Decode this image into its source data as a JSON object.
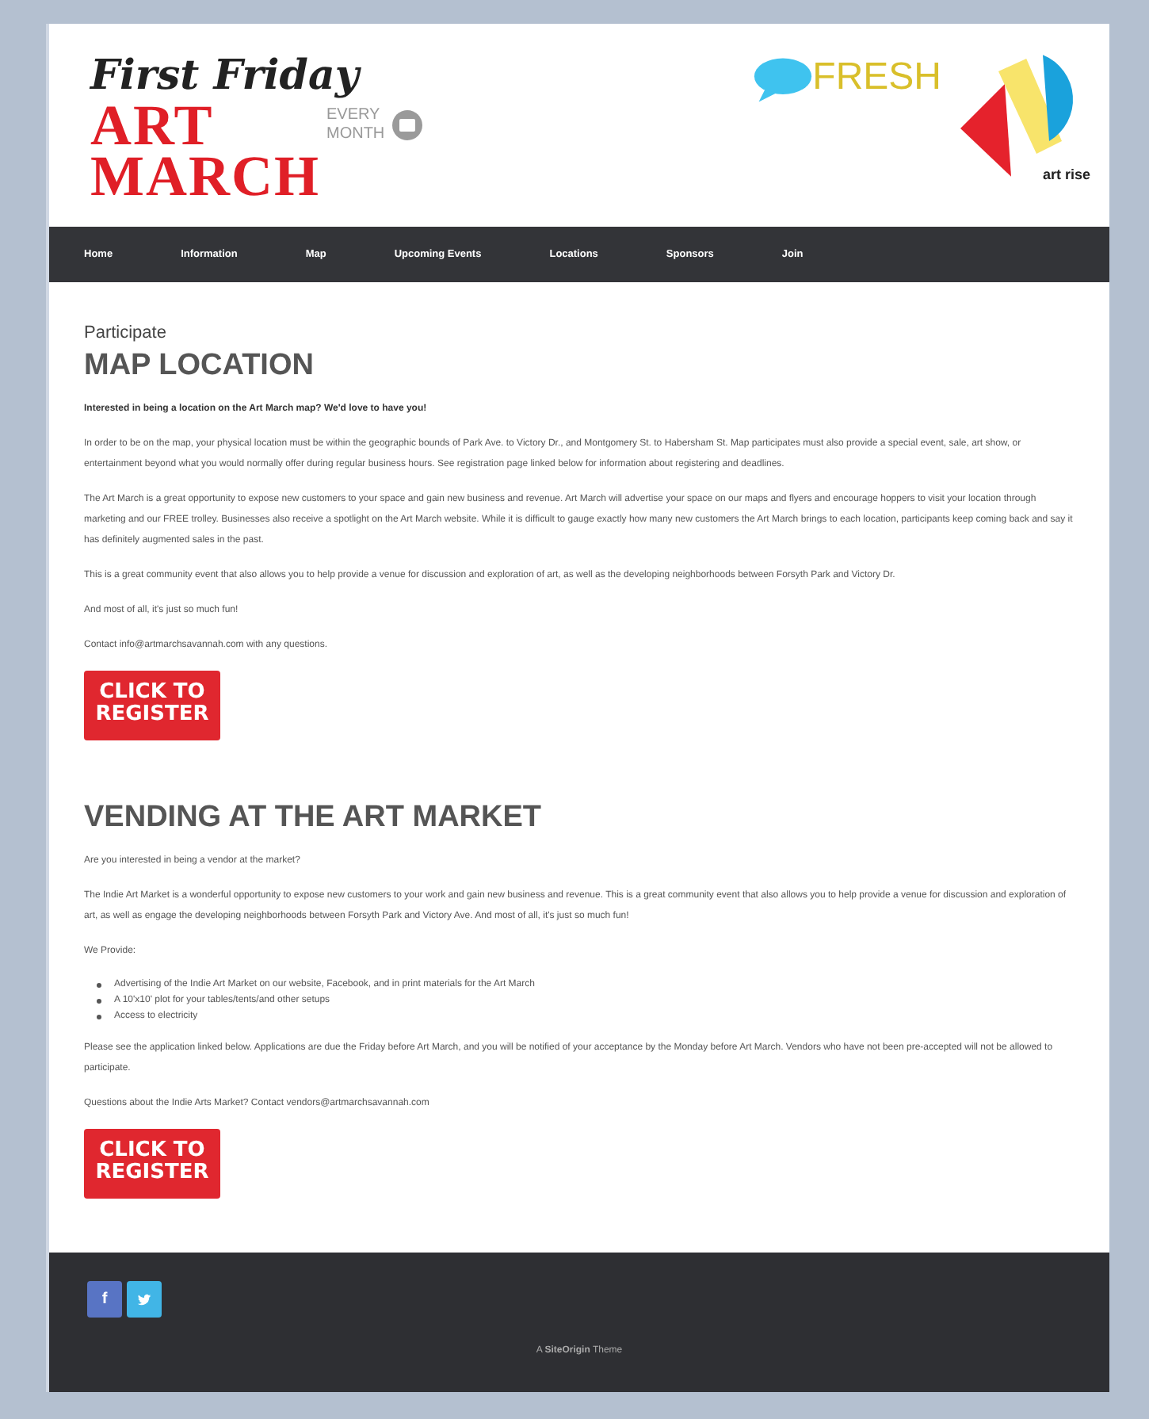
{
  "header": {
    "logo": {
      "script": "First Friday",
      "word1": "ART",
      "word2": "MARCH",
      "side1": "EVERY",
      "side2": "MONTH"
    },
    "partner1": {
      "name": "FRESH"
    },
    "partner2": {
      "name": "art rise"
    }
  },
  "nav": [
    {
      "label": "Home"
    },
    {
      "label": "Information"
    },
    {
      "label": "Map"
    },
    {
      "label": "Upcoming Events"
    },
    {
      "label": "Locations"
    },
    {
      "label": "Sponsors"
    },
    {
      "label": "Join"
    }
  ],
  "breadcrumb": "Participate",
  "sections": [
    {
      "heading": "MAP LOCATION",
      "blocks": [
        {
          "kind": "lead",
          "text": "Interested in being a location on the Art March map? We'd love to have you!"
        },
        {
          "kind": "text",
          "text": "In order to be on the map, your physical location must be within the geographic bounds of Park Ave. to Victory Dr., and Montgomery St. to Habersham St. Map participates must also provide a special event, sale, art show, or entertainment beyond what you would normally offer during regular business hours. See registration page linked below for information about registering and deadlines."
        },
        {
          "kind": "text",
          "text": "The Art March is a great opportunity to expose new customers to your space and gain new business and revenue. Art March will advertise your space on our maps and flyers and encourage hoppers to visit your location through marketing and our FREE trolley. Businesses also receive a spotlight on the Art March website. While it is difficult to gauge exactly how many new customers the Art March brings to each location, participants keep coming back and say it has definitely augmented sales in the past."
        },
        {
          "kind": "text",
          "text": "This is a great community event that also allows you to help provide a venue for discussion and exploration of art, as well as the developing neighborhoods between Forsyth Park and Victory Dr."
        },
        {
          "kind": "text",
          "text": "And most of all, it's just so much fun!"
        },
        {
          "kind": "text",
          "text": "Contact info@artmarchsavannah.com with any questions."
        }
      ],
      "button": "CLICK TO REGISTER"
    },
    {
      "heading": "VENDING AT THE ART MARKET",
      "blocks": [
        {
          "kind": "text",
          "text": "Are you interested in being a vendor at the market?"
        },
        {
          "kind": "text",
          "text": "The Indie Art Market is a wonderful opportunity to expose new customers to your work and gain new business and revenue.  This is a great community event that also allows you to help provide a venue for discussion and exploration of art, as well as engage the developing neighborhoods between Forsyth Park and Victory Ave. And most of all, it's just so much fun!"
        },
        {
          "kind": "text",
          "text": "We Provide:"
        },
        {
          "kind": "list",
          "items": [
            "Advertising of the Indie Art Market on our website, Facebook, and in print materials for the Art March",
            "A 10'x10' plot for your tables/tents/and other setups",
            "Access to electricity"
          ]
        },
        {
          "kind": "text",
          "text": "Please see the application linked below. Applications are due the Friday before Art March, and you will be notified of your acceptance by the Monday before Art March. Vendors who have not been pre-accepted will not be allowed to participate."
        },
        {
          "kind": "text",
          "text": "Questions about the Indie Arts Market? Contact vendors@artmarchsavannah.com"
        }
      ],
      "button": "CLICK TO REGISTER"
    }
  ],
  "footer": {
    "social": [
      {
        "kind": "facebook",
        "glyph": "f"
      },
      {
        "kind": "twitter"
      }
    ],
    "credit": "A **SiteOrigin** Theme"
  }
}
